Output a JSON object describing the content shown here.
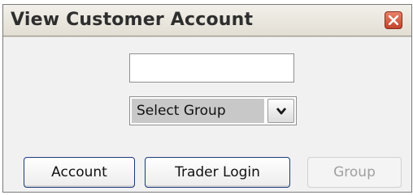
{
  "window": {
    "title": "View Customer Account"
  },
  "customer_input": {
    "value": "",
    "placeholder": ""
  },
  "group_select": {
    "selected": "Select Group"
  },
  "buttons": {
    "account": "Account",
    "trader_login": "Trader Login",
    "group": "Group"
  },
  "icons": {
    "close": "close-icon",
    "dropdown": "chevron-down-icon"
  },
  "colors": {
    "close_button": "#d9573c",
    "button_border": "#1c3a7a",
    "disabled_text": "#a0a0a0"
  }
}
